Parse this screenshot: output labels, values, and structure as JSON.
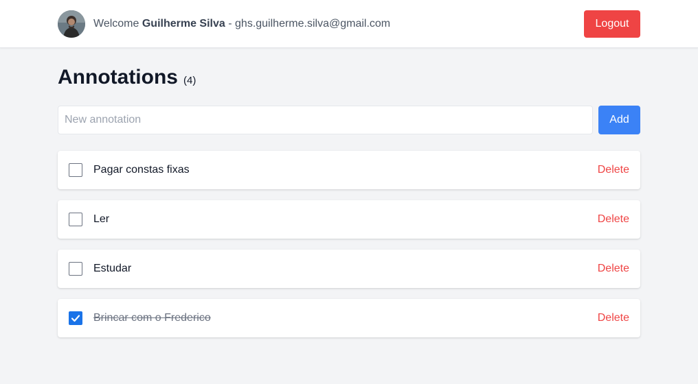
{
  "header": {
    "welcome_prefix": "Welcome",
    "user_name": "Guilherme Silva",
    "separator": "-",
    "email": "ghs.guilherme.silva@gmail.com",
    "logout_label": "Logout"
  },
  "page": {
    "title": "Annotations",
    "count": "(4)"
  },
  "form": {
    "placeholder": "New annotation",
    "value": "",
    "add_label": "Add"
  },
  "annotations": [
    {
      "text": "Pagar constas fixas",
      "done": false,
      "delete_label": "Delete"
    },
    {
      "text": "Ler",
      "done": false,
      "delete_label": "Delete"
    },
    {
      "text": "Estudar",
      "done": false,
      "delete_label": "Delete"
    },
    {
      "text": "Brincar com o Frederico",
      "done": true,
      "delete_label": "Delete"
    }
  ],
  "colors": {
    "background": "#f3f4f6",
    "danger": "#ef4444",
    "primary": "#3b82f6",
    "checkbox_checked": "#1a73e8"
  }
}
